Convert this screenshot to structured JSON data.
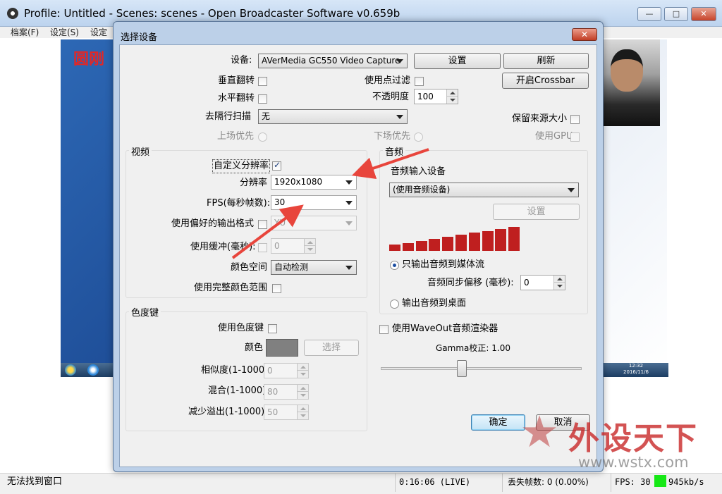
{
  "app": {
    "title": "Profile: Untitled - Scenes: scenes - Open Broadcaster Software v0.659b",
    "minimize_label": "—",
    "maximize_label": "□",
    "close_label": "✕",
    "menu": [
      "档案(F)",
      "设定(S)",
      "设定"
    ],
    "preview_text": "圆刚"
  },
  "dialog": {
    "title": "选择设备",
    "close_label": "✕",
    "device": {
      "label": "设备:",
      "value": "AVerMedia GC550 Video Capture"
    },
    "config_button": "设置",
    "refresh_button": "刷新",
    "crossbar_button": "开启Crossbar",
    "flip_vertical": "垂直翻转",
    "flip_horizontal": "水平翻转",
    "point_filter": "使用点过滤",
    "opacity": {
      "label": "不透明度",
      "value": "100"
    },
    "deinterlace": {
      "label": "去隔行扫描",
      "value": "无"
    },
    "keep_source_size": "保留来源大小",
    "top_field_first": "上场优先",
    "bottom_field_first": "下场优先",
    "use_gpu": "使用GPU",
    "video": {
      "title": "视频",
      "custom_resolution": "自定义分辨率",
      "resolution": {
        "label": "分辨率",
        "value": "1920x1080"
      },
      "fps": {
        "label": "FPS(每秒帧数):",
        "value": "30"
      },
      "preferred_output": {
        "label": "使用偏好的输出格式",
        "value": "YU"
      },
      "buffering": {
        "label": "使用缓冲(毫秒):",
        "value": "0"
      },
      "color_space": {
        "label": "颜色空间",
        "value": "自动检测"
      },
      "full_range": "使用完整颜色范围"
    },
    "color_key": {
      "title": "色度键",
      "use_color_key": "使用色度键",
      "color_label": "颜色",
      "select_button": "选择",
      "swatch_color": "#808080",
      "similarity": {
        "label": "相似度(1-1000):",
        "value": "0"
      },
      "blend": {
        "label": "混合(1-1000):",
        "value": "80"
      },
      "spill": {
        "label": "减少溢出(1-1000):",
        "value": "50"
      }
    },
    "audio": {
      "title": "音频",
      "input_device_label": "音频输入设备",
      "input_device_value": "(使用音频设备)",
      "config_button": "设置",
      "meter_color": "#bf1f1f",
      "meter_levels": [
        0.25,
        0.33,
        0.42,
        0.5,
        0.58,
        0.67,
        0.75,
        0.83,
        0.92,
        1.0
      ],
      "output_stream_only": "只输出音频到媒体流",
      "sync_offset": {
        "label": "音频同步偏移 (毫秒):",
        "value": "0"
      },
      "output_desktop": "输出音频到桌面"
    },
    "waveout": "使用WaveOut音频渲染器",
    "gamma": {
      "label": "Gamma校正:",
      "value": "1.00"
    },
    "ok_button": "确定",
    "cancel_button": "取消"
  },
  "status": {
    "message": "无法找到窗口",
    "time": "0:16:06 (LIVE)",
    "dropped_frames": "丢失帧数: 0 (0.00%)",
    "fps": "FPS: 30",
    "bitrate": "945kb/s",
    "fps_indicator_color": "#16e816"
  },
  "taskbar": {
    "clock_time": "12:32",
    "clock_date": "2016/11/6"
  },
  "watermark": {
    "text": "外设天下",
    "url": "www.wstx.com"
  }
}
